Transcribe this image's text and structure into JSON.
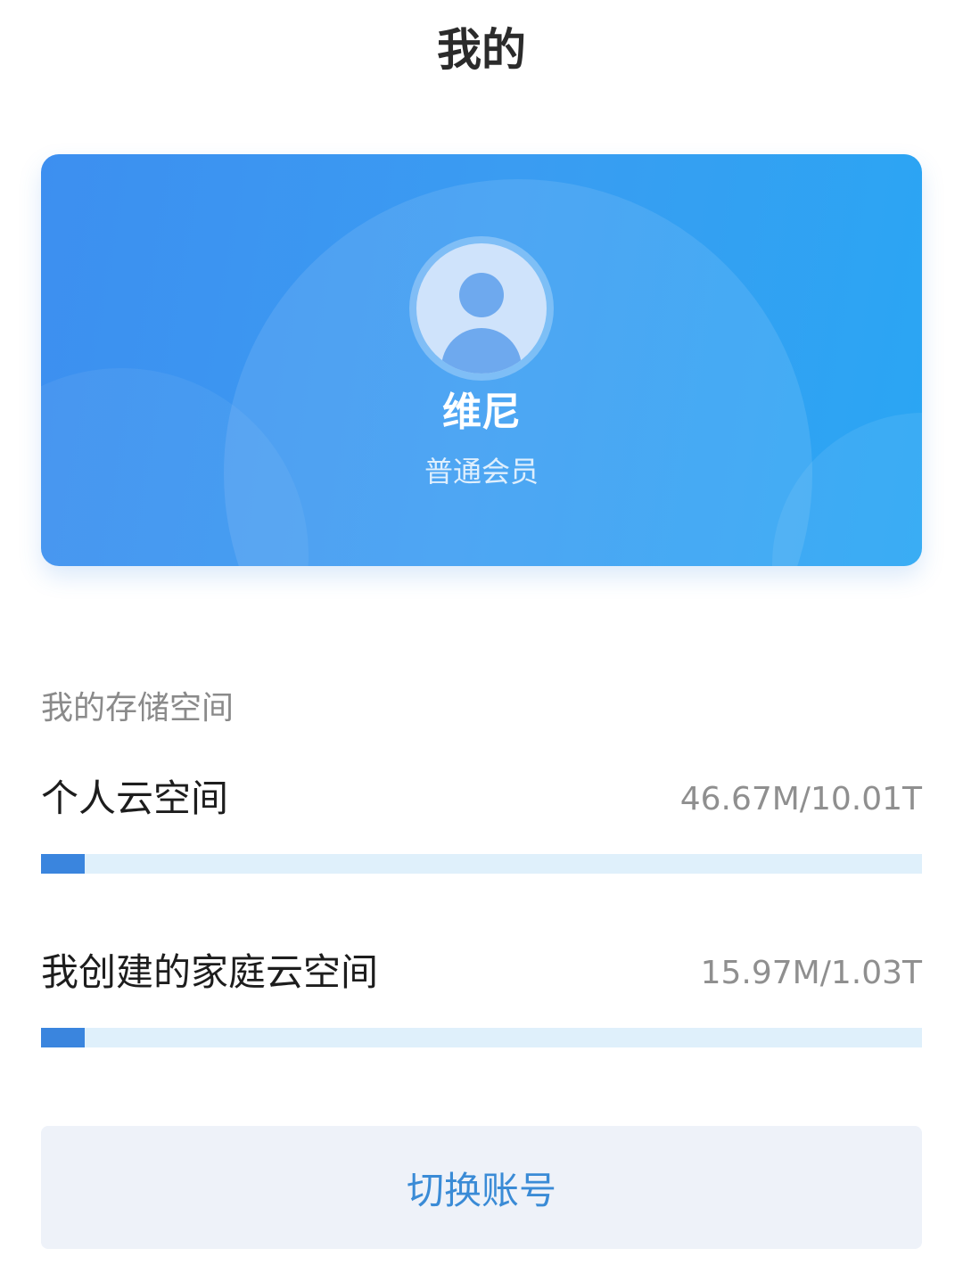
{
  "header": {
    "title": "我的"
  },
  "profile": {
    "name": "维尼",
    "level": "普通会员"
  },
  "storage": {
    "section_label": "我的存储空间",
    "items": [
      {
        "label": "个人云空间",
        "usage": "46.67M/10.01T",
        "fill_fraction": 0.05
      },
      {
        "label": "我创建的家庭云空间",
        "usage": "15.97M/1.03T",
        "fill_fraction": 0.05
      }
    ]
  },
  "actions": {
    "switch_account": "切换账号"
  },
  "colors": {
    "accent": "#3a85de",
    "card_gradient_start": "#3d8ff0",
    "card_gradient_end": "#2aa6f3",
    "track": "#dff0fb"
  },
  "icons": {
    "avatar": "user-avatar-icon"
  }
}
